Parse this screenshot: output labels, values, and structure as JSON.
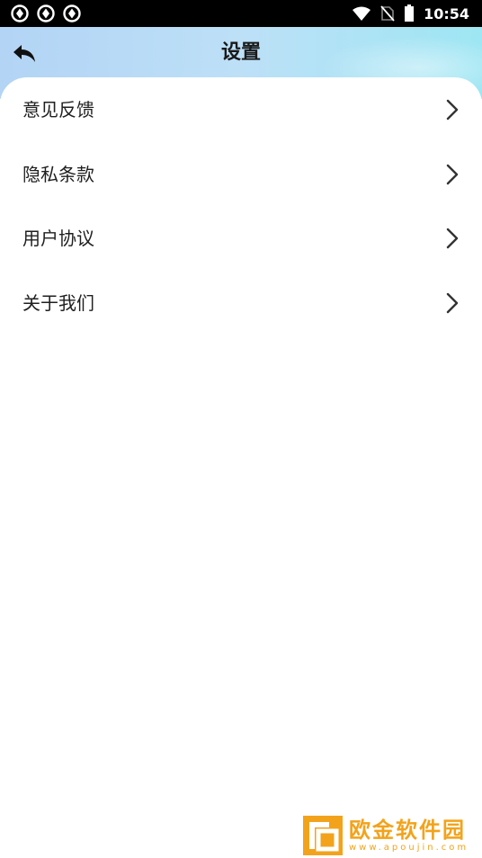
{
  "status_bar": {
    "time": "10:54",
    "left_icons": [
      "sync-icon",
      "sync-icon",
      "sync-icon"
    ],
    "right_icons": [
      "wifi-icon",
      "no-sim-icon",
      "battery-icon"
    ]
  },
  "header": {
    "title": "设置",
    "back_icon": "back-arrow-icon",
    "gradient_colors": [
      "#b3d4f5",
      "#9ee6f3"
    ]
  },
  "menu": {
    "items": [
      {
        "label": "意见反馈"
      },
      {
        "label": "隐私条款"
      },
      {
        "label": "用户协议"
      },
      {
        "label": "关于我们"
      }
    ]
  },
  "watermark": {
    "title": "欧金软件园",
    "url": "www.apoujin.com",
    "color": "#f2a31b"
  }
}
